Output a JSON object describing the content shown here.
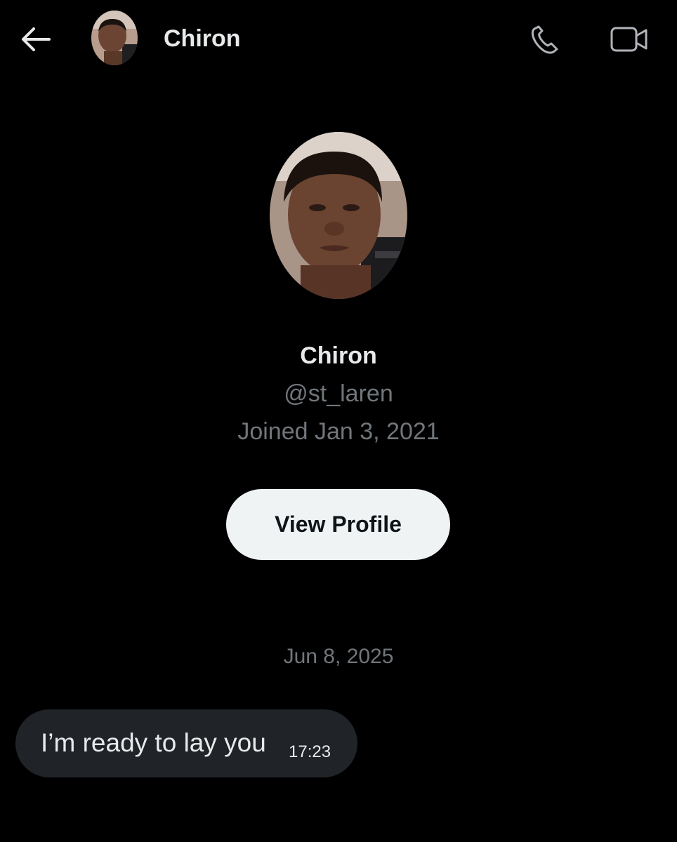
{
  "header": {
    "back_icon": "arrow-left-icon",
    "name": "Chiron",
    "call_icon": "phone-icon",
    "video_icon": "video-camera-icon"
  },
  "profile": {
    "name": "Chiron",
    "handle": "@st_laren",
    "joined": "Joined Jan 3, 2021",
    "view_profile_label": "View Profile"
  },
  "conversation": {
    "date": "Jun 8, 2025",
    "messages": [
      {
        "text": "I’m ready to lay you",
        "time": "17:23"
      }
    ]
  },
  "colors": {
    "background": "#000000",
    "primary_text": "#e7e9ea",
    "secondary_text": "#71767b",
    "button_bg": "#eff3f4",
    "button_text": "#0f1419",
    "bubble_bg": "#202327"
  }
}
